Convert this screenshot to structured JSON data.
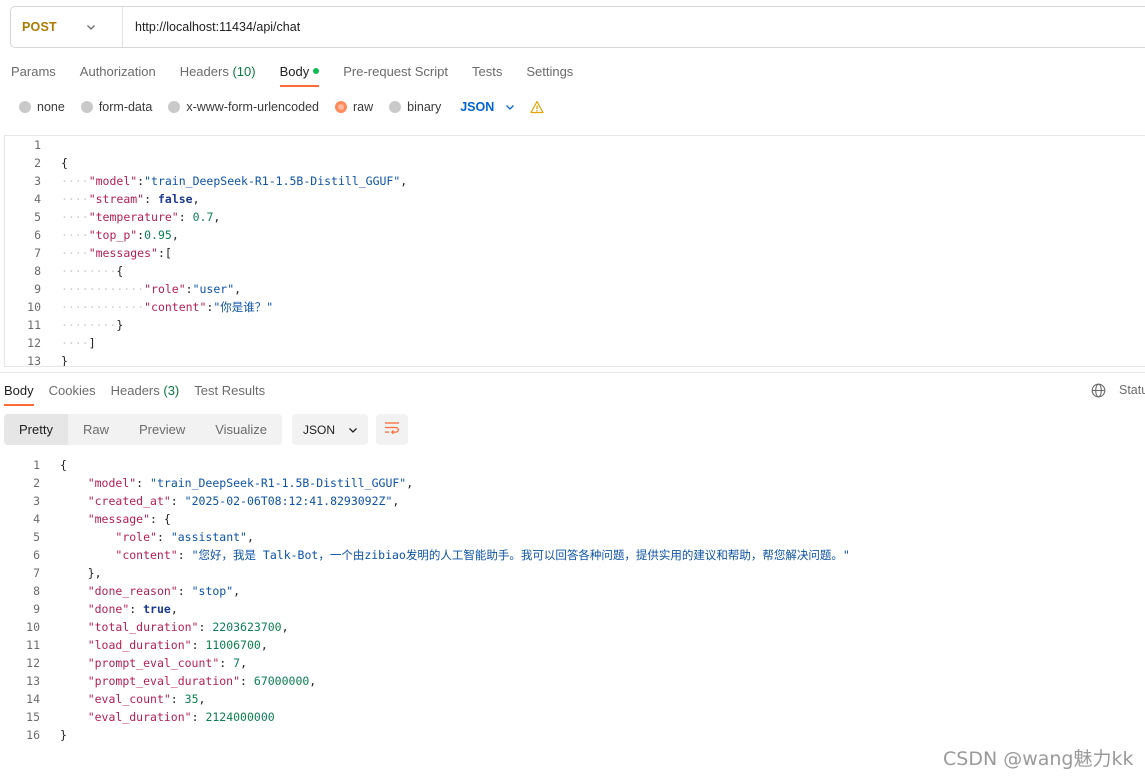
{
  "request": {
    "method": "POST",
    "url": "http://localhost:11434/api/chat"
  },
  "request_tabs": [
    {
      "label": "Params"
    },
    {
      "label": "Authorization"
    },
    {
      "label": "Headers",
      "count": "(10)"
    },
    {
      "label": "Body"
    },
    {
      "label": "Pre-request Script"
    },
    {
      "label": "Tests"
    },
    {
      "label": "Settings"
    }
  ],
  "body_types": [
    "none",
    "form-data",
    "x-www-form-urlencoded",
    "raw",
    "binary"
  ],
  "body_language": "JSON",
  "request_body_lines": [
    "",
    "{",
    "    \"model\":\"train_DeepSeek-R1-1.5B-Distill_GGUF\",",
    "    \"stream\": false,",
    "    \"temperature\": 0.7,",
    "    \"top_p\":0.95,",
    "    \"messages\":[",
    "        {",
    "            \"role\":\"user\",",
    "            \"content\":\"你是谁？\"",
    "        }",
    "    ]",
    "}"
  ],
  "response_tabs": [
    {
      "label": "Body"
    },
    {
      "label": "Cookies"
    },
    {
      "label": "Headers",
      "count": "(3)"
    },
    {
      "label": "Test Results"
    }
  ],
  "status_label": "Statu",
  "view_modes": [
    "Pretty",
    "Raw",
    "Preview",
    "Visualize"
  ],
  "response_format": "JSON",
  "response_body_lines": [
    "{",
    "    \"model\": \"train_DeepSeek-R1-1.5B-Distill_GGUF\",",
    "    \"created_at\": \"2025-02-06T08:12:41.8293092Z\",",
    "    \"message\": {",
    "        \"role\": \"assistant\",",
    "        \"content\": \"您好，我是 Talk-Bot，一个由zibiao发明的人工智能助手。我可以回答各种问题，提供实用的建议和帮助，帮您解决问题。\"",
    "    },",
    "    \"done_reason\": \"stop\",",
    "    \"done\": true,",
    "    \"total_duration\": 2203623700,",
    "    \"load_duration\": 11006700,",
    "    \"prompt_eval_count\": 7,",
    "    \"prompt_eval_duration\": 67000000,",
    "    \"eval_count\": 35,",
    "    \"eval_duration\": 2124000000",
    "}"
  ],
  "watermark": "CSDN @wang魅力kk",
  "colors": {
    "accent": "#ff6c37",
    "method": "#ad7a03",
    "lang": "#0265d2",
    "dot": "#0cbb52"
  },
  "icons": [
    "chevron-down-icon",
    "warning-icon",
    "globe-icon",
    "wrap-lines-icon"
  ]
}
